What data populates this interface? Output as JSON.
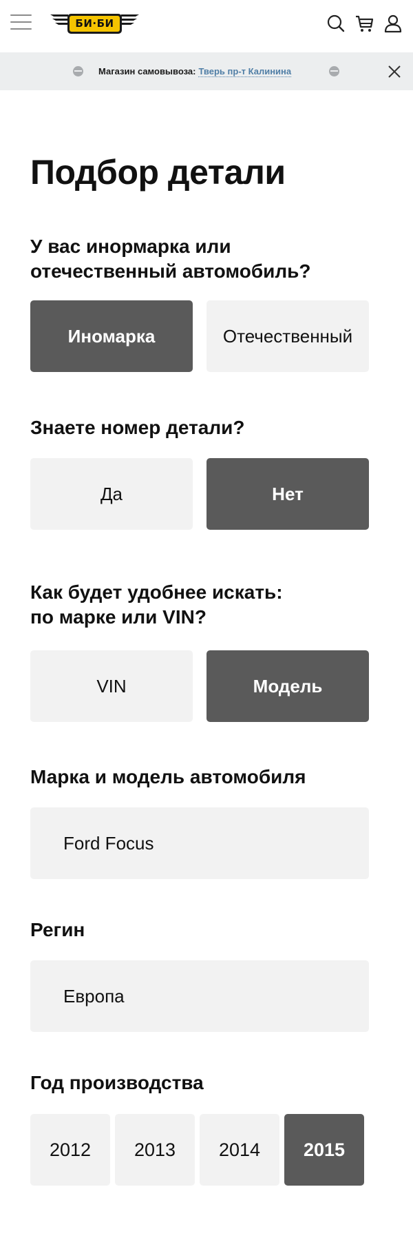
{
  "header": {
    "logo_text": "БИ·БИ",
    "icons": [
      "menu-icon",
      "search-icon",
      "cart-icon",
      "user-icon"
    ]
  },
  "banner": {
    "label": "Магазин самовывоза:",
    "store_link": "Тверь пр-т Калинина"
  },
  "page": {
    "title": "Подбор детали"
  },
  "q_car_origin": {
    "line1": "У вас инормарка или",
    "line2": "отечественный автомобиль?",
    "options": [
      "Иномарка",
      "Отечественный"
    ],
    "selected": "Иномарка"
  },
  "q_part_number": {
    "question": "Знаете номер детали?",
    "options": [
      "Да",
      "Нет"
    ],
    "selected": "Нет"
  },
  "q_search_method": {
    "line1": "Как будет удобнее искать:",
    "line2": "по марке или  VIN?",
    "options": [
      "VIN",
      "Модель"
    ],
    "selected": "Модель"
  },
  "car_model": {
    "label": "Марка и модель автомобиля",
    "value": "Ford Focus"
  },
  "region": {
    "label": "Регин",
    "value": "Европа"
  },
  "year": {
    "label": "Год производства",
    "options": [
      "2012",
      "2013",
      "2014",
      "2015"
    ],
    "selected": "2015"
  },
  "colors": {
    "selected_bg": "#5a5a5a",
    "option_bg": "#f2f2f2",
    "banner_bg": "#eceeef",
    "link": "#4f7ea6",
    "logo_yellow": "#f5c400"
  }
}
